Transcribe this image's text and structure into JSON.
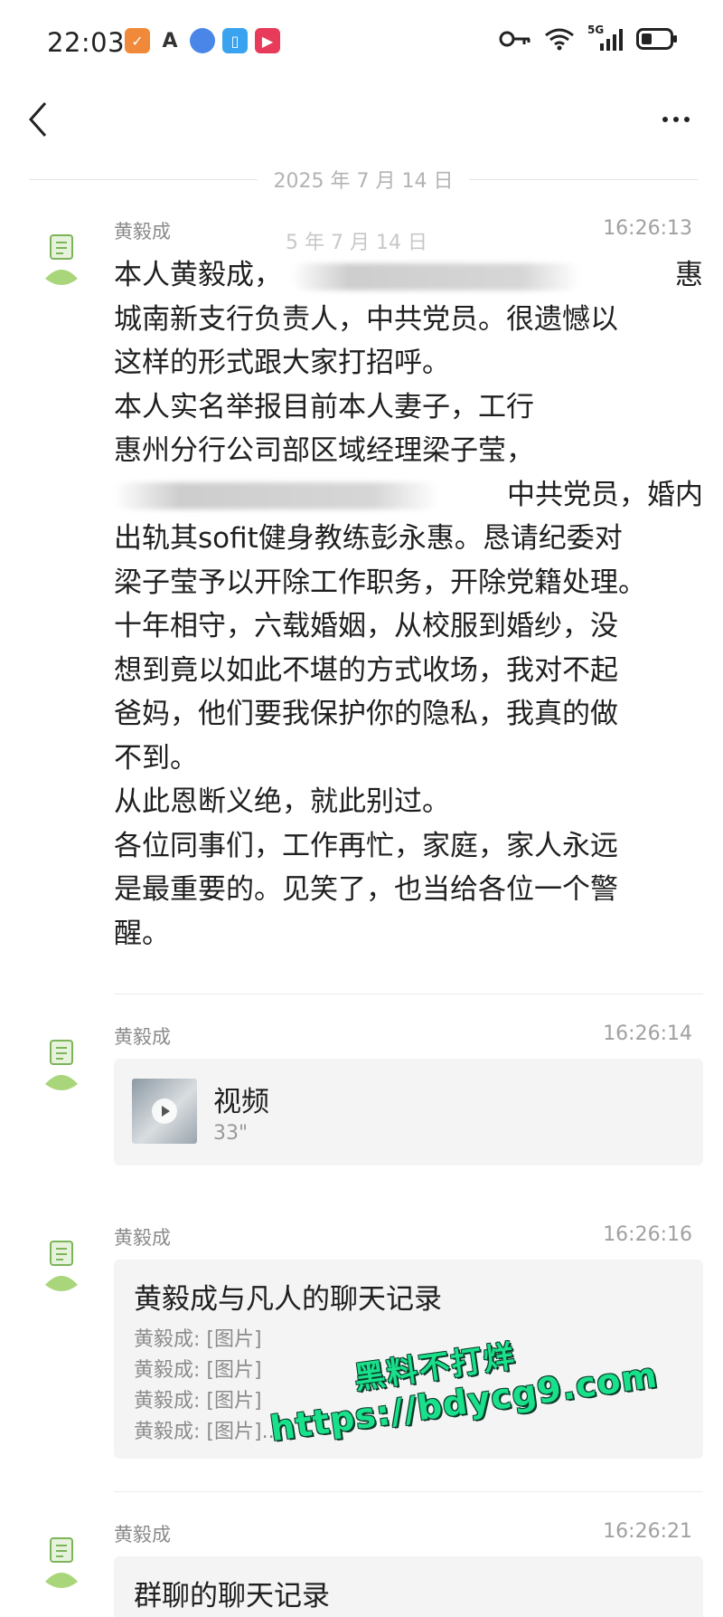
{
  "status_bar": {
    "time": "22:03",
    "network": "5G",
    "icons": [
      "shield-app-icon",
      "a-app-icon",
      "browser-app-icon",
      "book-app-icon",
      "video-app-icon",
      "key-icon",
      "wifi-icon",
      "signal-icon",
      "battery-icon"
    ],
    "colors": {
      "shield": "#f08a3a",
      "book": "#3aa3f0",
      "video": "#e83a5a"
    }
  },
  "chat": {
    "date_separator": "2025 年 7 月 14 日",
    "messages": [
      {
        "sender": "黄毅成",
        "time": "16:26:13",
        "ghost_date": "5 年 7 月 14 日",
        "lines": [
          "本人黄毅成，",
          "惠",
          "城南新支行负责人，中共党员。很遗憾以",
          "这样的形式跟大家打招呼。",
          "本人实名举报目前本人妻子，工行",
          "惠州分行公司部区域经理梁子莹，",
          "中共党员，婚内",
          "出轨其sofit健身教练彭永惠。恳请纪委对",
          "梁子莹予以开除工作职务，开除党籍处理。",
          "十年相守，六载婚姻，从校服到婚纱，没",
          "想到竟以如此不堪的方式收场，我对不起",
          "爸妈，他们要我保护你的隐私，我真的做",
          "不到。",
          "从此恩断义绝，就此别过。",
          "各位同事们，工作再忙，家庭，家人永远",
          "是最重要的。见笑了，也当给各位一个警",
          "醒。"
        ]
      },
      {
        "sender": "黄毅成",
        "time": "16:26:14",
        "video_title": "视频",
        "video_duration": "33\""
      },
      {
        "sender": "黄毅成",
        "time": "16:26:16",
        "record_title": "黄毅成与凡人的聊天记录",
        "record_lines": [
          "黄毅成: [图片]",
          "黄毅成: [图片]",
          "黄毅成: [图片]",
          "黄毅成: [图片]..."
        ]
      },
      {
        "sender": "黄毅成",
        "time": "16:26:21",
        "record_title": "群聊的聊天记录"
      }
    ]
  },
  "watermark": {
    "line1": "黑料不打烊",
    "line2": "https://bdycg9.com"
  }
}
